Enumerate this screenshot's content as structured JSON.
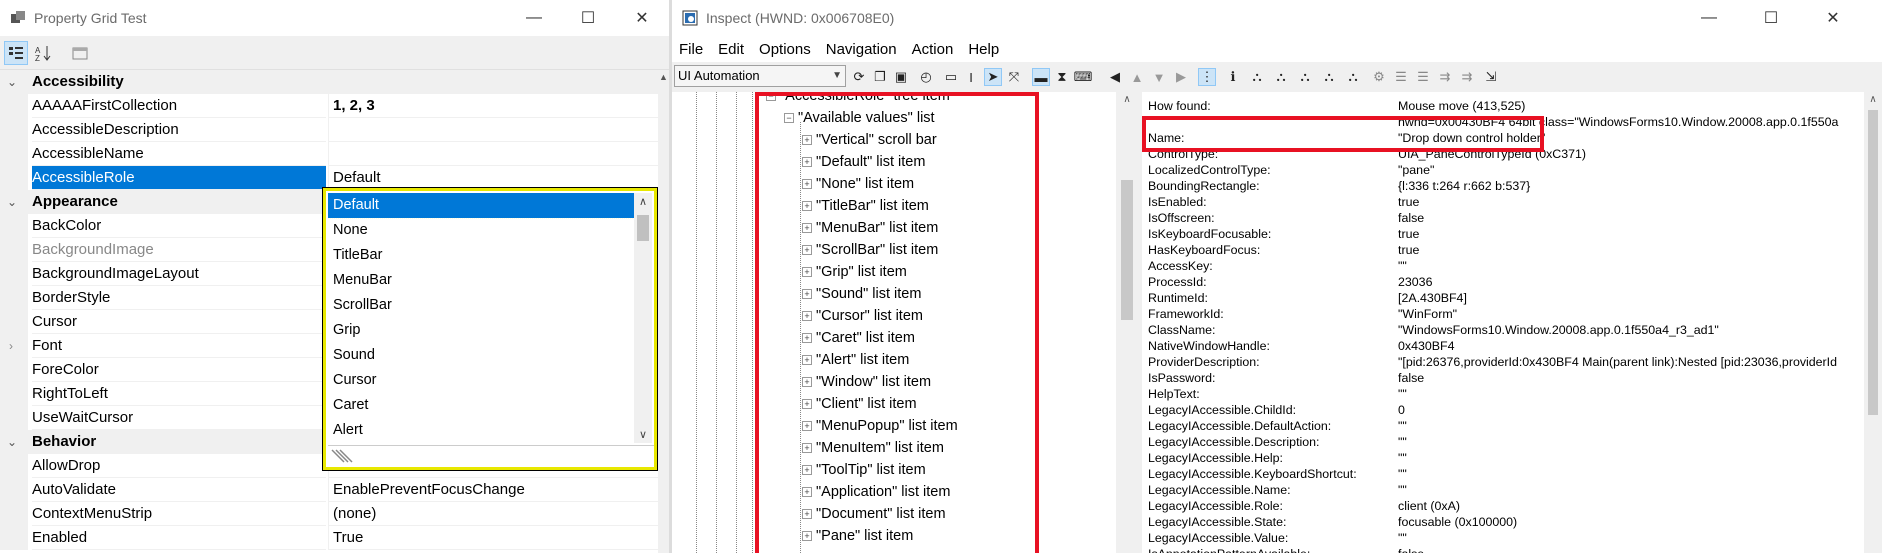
{
  "left_window": {
    "title": "Property Grid Test",
    "rows": [
      {
        "type": "cat",
        "name": "Accessibility"
      },
      {
        "type": "prop",
        "name": "AAAAAFirstCollection",
        "value": "1, 2, 3",
        "bold": true
      },
      {
        "type": "prop",
        "name": "AccessibleDescription",
        "value": ""
      },
      {
        "type": "prop",
        "name": "AccessibleName",
        "value": ""
      },
      {
        "type": "prop",
        "name": "AccessibleRole",
        "value": "Default",
        "selected": true
      },
      {
        "type": "cat",
        "name": "Appearance"
      },
      {
        "type": "prop",
        "name": "BackColor",
        "value": ""
      },
      {
        "type": "prop",
        "name": "BackgroundImage",
        "value": "",
        "dim": true
      },
      {
        "type": "prop",
        "name": "BackgroundImageLayout",
        "value": ""
      },
      {
        "type": "prop",
        "name": "BorderStyle",
        "value": ""
      },
      {
        "type": "prop",
        "name": "Cursor",
        "value": ""
      },
      {
        "type": "prop",
        "name": "Font",
        "value": "",
        "expandable": true
      },
      {
        "type": "prop",
        "name": "ForeColor",
        "value": ""
      },
      {
        "type": "prop",
        "name": "RightToLeft",
        "value": ""
      },
      {
        "type": "prop",
        "name": "UseWaitCursor",
        "value": ""
      },
      {
        "type": "cat",
        "name": "Behavior"
      },
      {
        "type": "prop",
        "name": "AllowDrop",
        "value": ""
      },
      {
        "type": "prop",
        "name": "AutoValidate",
        "value": "EnablePreventFocusChange"
      },
      {
        "type": "prop",
        "name": "ContextMenuStrip",
        "value": "(none)"
      },
      {
        "type": "prop",
        "name": "Enabled",
        "value": "True"
      }
    ],
    "dropdown_items": [
      "Default",
      "None",
      "TitleBar",
      "MenuBar",
      "ScrollBar",
      "Grip",
      "Sound",
      "Cursor",
      "Caret",
      "Alert"
    ],
    "dropdown_selected": "Default"
  },
  "right_window": {
    "title": "Inspect  (HWND: 0x006708E0)",
    "menu": [
      "File",
      "Edit",
      "Options",
      "Navigation",
      "Action",
      "Help"
    ],
    "mode": "UI Automation",
    "tree": [
      {
        "label": "\"AccessibleRole\" tree item",
        "level": 0,
        "box": "⊟"
      },
      {
        "label": "\"Available values\" list",
        "level": 1,
        "box": "⊟"
      },
      {
        "label": "\"Vertical\" scroll bar",
        "level": 2,
        "box": "+"
      },
      {
        "label": "\"Default\" list item",
        "level": 2,
        "box": "+"
      },
      {
        "label": "\"None\" list item",
        "level": 2,
        "box": "+"
      },
      {
        "label": "\"TitleBar\" list item",
        "level": 2,
        "box": "+"
      },
      {
        "label": "\"MenuBar\" list item",
        "level": 2,
        "box": "+"
      },
      {
        "label": "\"ScrollBar\" list item",
        "level": 2,
        "box": "+"
      },
      {
        "label": "\"Grip\" list item",
        "level": 2,
        "box": "+"
      },
      {
        "label": "\"Sound\" list item",
        "level": 2,
        "box": "+"
      },
      {
        "label": "\"Cursor\" list item",
        "level": 2,
        "box": "+"
      },
      {
        "label": "\"Caret\" list item",
        "level": 2,
        "box": "+"
      },
      {
        "label": "\"Alert\" list item",
        "level": 2,
        "box": "+"
      },
      {
        "label": "\"Window\" list item",
        "level": 2,
        "box": "+"
      },
      {
        "label": "\"Client\" list item",
        "level": 2,
        "box": "+"
      },
      {
        "label": "\"MenuPopup\" list item",
        "level": 2,
        "box": "+"
      },
      {
        "label": "\"MenuItem\" list item",
        "level": 2,
        "box": "+"
      },
      {
        "label": "\"ToolTip\" list item",
        "level": 2,
        "box": "+"
      },
      {
        "label": "\"Application\" list item",
        "level": 2,
        "box": "+"
      },
      {
        "label": "\"Document\" list item",
        "level": 2,
        "box": "+"
      },
      {
        "label": "\"Pane\" list item",
        "level": 2,
        "box": "+"
      }
    ],
    "properties": [
      {
        "k": "How found:",
        "v": "Mouse move (413,525)"
      },
      {
        "k": "",
        "v": "hwnd=0x00430BF4 64bit class=\"WindowsForms10.Window.20008.app.0.1f550a"
      },
      {
        "k": "Name:",
        "v": "\"Drop down control holder\""
      },
      {
        "k": "ControlType:",
        "v": "UIA_PaneControlTypeId (0xC371)"
      },
      {
        "k": "LocalizedControlType:",
        "v": "\"pane\""
      },
      {
        "k": "BoundingRectangle:",
        "v": "{l:336 t:264 r:662 b:537}"
      },
      {
        "k": "IsEnabled:",
        "v": "true"
      },
      {
        "k": "IsOffscreen:",
        "v": "false"
      },
      {
        "k": "IsKeyboardFocusable:",
        "v": "true"
      },
      {
        "k": "HasKeyboardFocus:",
        "v": "true"
      },
      {
        "k": "AccessKey:",
        "v": "\"\""
      },
      {
        "k": "ProcessId:",
        "v": "23036"
      },
      {
        "k": "RuntimeId:",
        "v": "[2A.430BF4]"
      },
      {
        "k": "FrameworkId:",
        "v": "\"WinForm\""
      },
      {
        "k": "ClassName:",
        "v": "\"WindowsForms10.Window.20008.app.0.1f550a4_r3_ad1\""
      },
      {
        "k": "NativeWindowHandle:",
        "v": "0x430BF4"
      },
      {
        "k": "ProviderDescription:",
        "v": "\"[pid:26376,providerId:0x430BF4 Main(parent link):Nested [pid:23036,providerId"
      },
      {
        "k": "IsPassword:",
        "v": "false"
      },
      {
        "k": "HelpText:",
        "v": "\"\""
      },
      {
        "k": "LegacyIAccessible.ChildId:",
        "v": "0"
      },
      {
        "k": "LegacyIAccessible.DefaultAction:",
        "v": "\"\""
      },
      {
        "k": "LegacyIAccessible.Description:",
        "v": "\"\""
      },
      {
        "k": "LegacyIAccessible.Help:",
        "v": "\"\""
      },
      {
        "k": "LegacyIAccessible.KeyboardShortcut:",
        "v": "\"\""
      },
      {
        "k": "LegacyIAccessible.Name:",
        "v": "\"\""
      },
      {
        "k": "LegacyIAccessible.Role:",
        "v": "client (0xA)"
      },
      {
        "k": "LegacyIAccessible.State:",
        "v": "focusable (0x100000)"
      },
      {
        "k": "LegacyIAccessible.Value:",
        "v": "\"\""
      },
      {
        "k": "IsAnnotationPatternAvailable:",
        "v": "false"
      }
    ]
  },
  "colors": {
    "selection": "#0078d7",
    "highlight_red": "#e81123",
    "dropdown_border": "#e8e800"
  }
}
